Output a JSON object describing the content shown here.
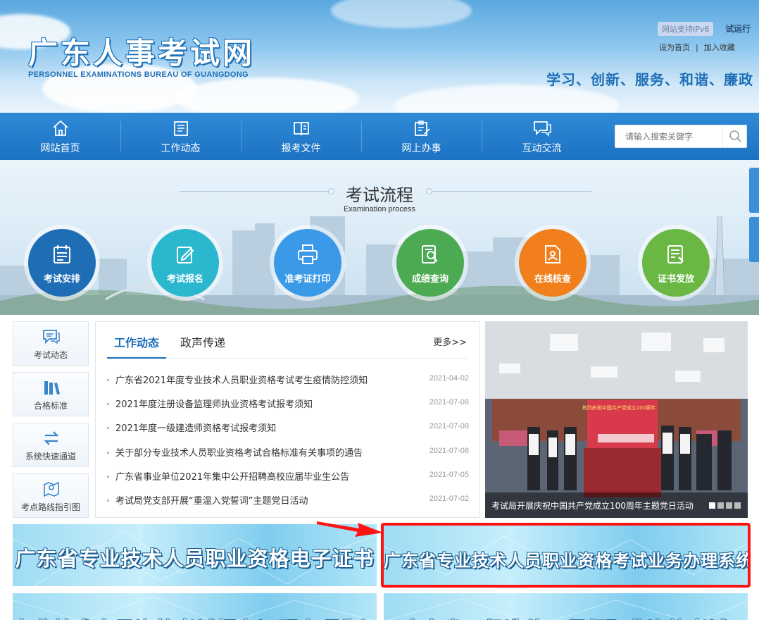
{
  "header": {
    "site_title": "广东人事考试网",
    "site_subtitle": "PERSONNEL EXAMINATIONS BUREAU OF GUANGDONG",
    "ipv6_badge": "网站支持IPv6",
    "trial_label": "试运行",
    "set_home": "设为首页",
    "separator": "|",
    "add_favorite": "加入收藏",
    "slogan": "学习、创新、服务、和谐、廉政"
  },
  "nav": {
    "items": [
      {
        "label": "网站首页",
        "icon": "home-icon"
      },
      {
        "label": "工作动态",
        "icon": "news-icon"
      },
      {
        "label": "报考文件",
        "icon": "book-icon"
      },
      {
        "label": "网上办事",
        "icon": "clipboard-edit-icon"
      },
      {
        "label": "互动交流",
        "icon": "chat-icon"
      }
    ],
    "search_placeholder": "请输入搜索关键字"
  },
  "process": {
    "title": "考试流程",
    "subtitle": "Examination process",
    "steps": [
      {
        "label": "考试安排",
        "icon": "calendar-icon",
        "color": "#1f6db5"
      },
      {
        "label": "考试报名",
        "icon": "pencil-icon",
        "color": "#2bb8cf"
      },
      {
        "label": "准考证打印",
        "icon": "printer-icon",
        "color": "#3a9ae8"
      },
      {
        "label": "成绩查询",
        "icon": "search-doc-icon",
        "color": "#4cab52"
      },
      {
        "label": "在线核查",
        "icon": "user-doc-icon",
        "color": "#f07f1c"
      },
      {
        "label": "证书发放",
        "icon": "certificate-icon",
        "color": "#6ab843"
      }
    ]
  },
  "quick_links": [
    {
      "label": "考试动态",
      "icon": "chat-bubble-icon"
    },
    {
      "label": "合格标准",
      "icon": "books-icon"
    },
    {
      "label": "系统快速通道",
      "icon": "swap-arrows-icon"
    },
    {
      "label": "考点路线指引图",
      "icon": "map-pin-icon"
    }
  ],
  "news": {
    "tabs": [
      "工作动态",
      "政声传递"
    ],
    "more": "更多>>",
    "items": [
      {
        "title": "广东省2021年度专业技术人员职业资格考试考生疫情防控须知",
        "date": "2021-04-02"
      },
      {
        "title": "2021年度注册设备监理师执业资格考试报考须知",
        "date": "2021-07-08"
      },
      {
        "title": "2021年度一级建造师资格考试报考须知",
        "date": "2021-07-08"
      },
      {
        "title": "关于部分专业技术人员职业资格考试合格标准有关事项的通告",
        "date": "2021-07-08"
      },
      {
        "title": "广东省事业单位2021年集中公开招聘高校应届毕业生公告",
        "date": "2021-07-05"
      },
      {
        "title": "考试局党支部开展“重温入党誓词”主题党日活动",
        "date": "2021-07-02"
      }
    ]
  },
  "photo": {
    "caption": "考试局开展庆祝中国共产党成立100周年主题党日活动",
    "banner_text": "热烈庆祝中国共产党成立100周年",
    "pages": 4,
    "active_page": 1
  },
  "banners": {
    "certificate": "广东省专业技术人员职业资格电子证书",
    "business_system": "广东省专业技术人员职业资格考试业务办理系统",
    "bottom_left": "专业技术人员资格考试报名证明事项告知承诺制",
    "bottom_right": "广东省二级造价工程师职业资格考试"
  },
  "colors": {
    "primary": "#1c72c4",
    "highlight_box": "#ff1414",
    "arrow": "#ff1414"
  }
}
